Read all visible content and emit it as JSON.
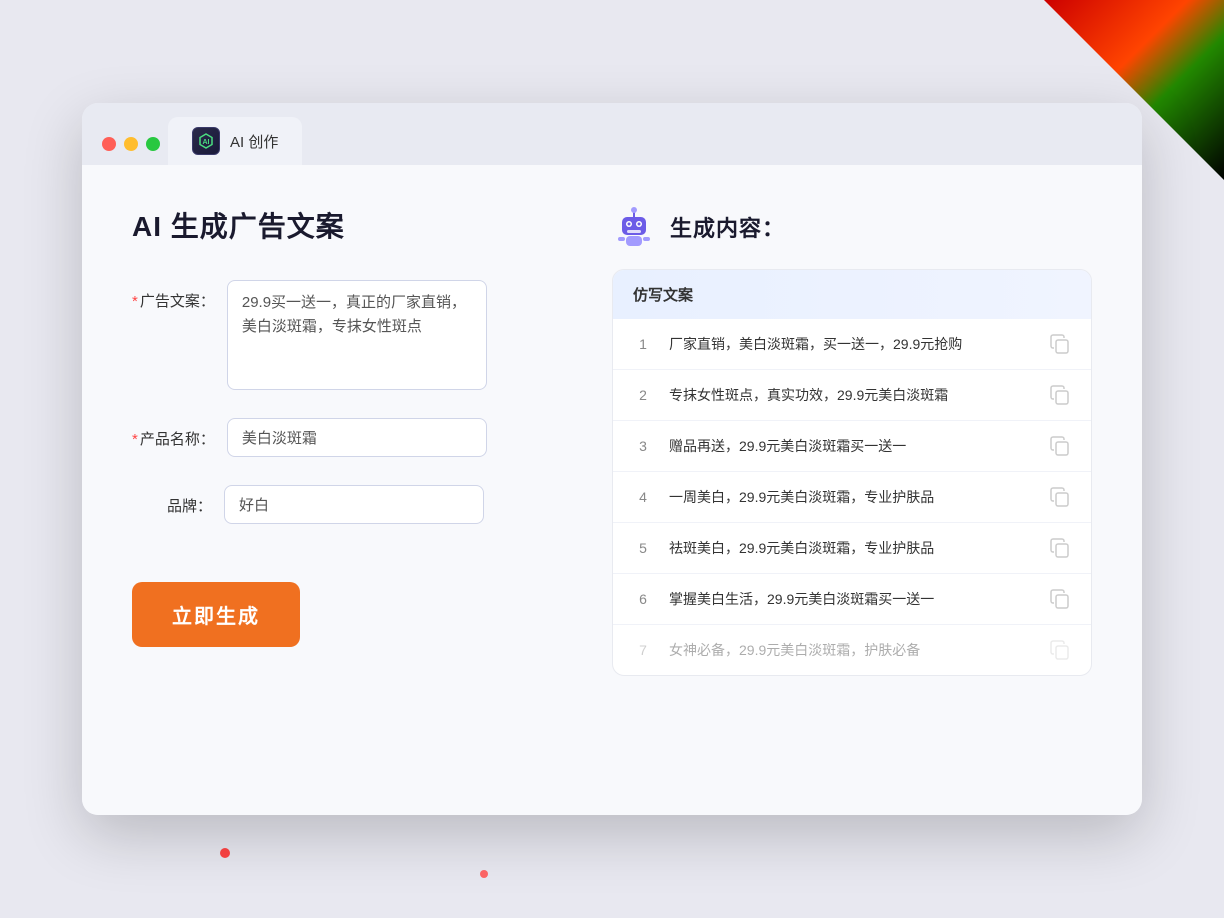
{
  "deco": {
    "top_right": "decorative corner"
  },
  "browser": {
    "controls": {
      "red_label": "close",
      "yellow_label": "minimize",
      "green_label": "maximize"
    },
    "tab": {
      "icon_text": "AI",
      "label": "AI 创作"
    }
  },
  "left_panel": {
    "title": "AI 生成广告文案",
    "form": {
      "ad_copy_label": "广告文案：",
      "ad_copy_required": "*",
      "ad_copy_value": "29.9买一送一，真正的厂家直销，美白淡斑霜，专抹女性斑点",
      "product_name_label": "产品名称：",
      "product_name_required": "*",
      "product_name_value": "美白淡斑霜",
      "brand_label": "品牌：",
      "brand_value": "好白"
    },
    "generate_button": "立即生成"
  },
  "right_panel": {
    "title": "生成内容：",
    "robot_icon": "robot-icon",
    "table": {
      "header": "仿写文案",
      "rows": [
        {
          "num": "1",
          "text": "厂家直销，美白淡斑霜，买一送一，29.9元抢购",
          "faded": false
        },
        {
          "num": "2",
          "text": "专抹女性斑点，真实功效，29.9元美白淡斑霜",
          "faded": false
        },
        {
          "num": "3",
          "text": "赠品再送，29.9元美白淡斑霜买一送一",
          "faded": false
        },
        {
          "num": "4",
          "text": "一周美白，29.9元美白淡斑霜，专业护肤品",
          "faded": false
        },
        {
          "num": "5",
          "text": "祛斑美白，29.9元美白淡斑霜，专业护肤品",
          "faded": false
        },
        {
          "num": "6",
          "text": "掌握美白生活，29.9元美白淡斑霜买一送一",
          "faded": false
        },
        {
          "num": "7",
          "text": "女神必备，29.9元美白淡斑霜，护肤必备",
          "faded": true
        }
      ]
    }
  }
}
